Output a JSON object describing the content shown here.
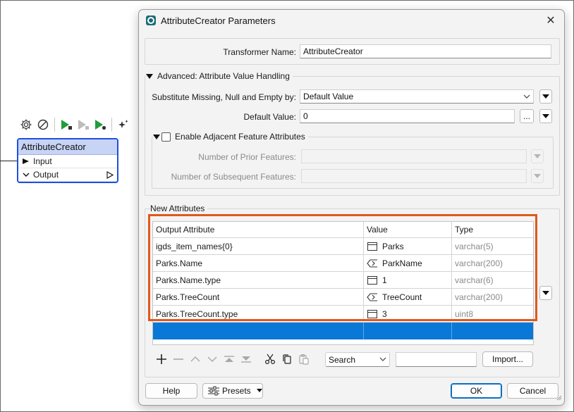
{
  "canvas": {
    "node_title": "AttributeCreator",
    "port_input": "Input",
    "port_output": "Output",
    "toolbar_icons": [
      "gear-icon",
      "disable-icon",
      "run-to-icon",
      "run-from-icon",
      "run-partial-icon",
      "sparkle-icon"
    ]
  },
  "dialog": {
    "title": "AttributeCreator Parameters",
    "transformer_name_label": "Transformer Name:",
    "transformer_name_value": "AttributeCreator",
    "advanced_section": "Advanced: Attribute Value Handling",
    "substitute_label": "Substitute Missing, Null and Empty by:",
    "substitute_value": "Default Value",
    "default_value_label": "Default Value:",
    "default_value_value": "0",
    "ellipsis": "...",
    "adjacent_label": "Enable Adjacent Feature Attributes",
    "prior_label": "Number of Prior Features:",
    "subsequent_label": "Number of Subsequent Features:",
    "new_attributes_label": "New Attributes",
    "table": {
      "headers": [
        "Output Attribute",
        "Value",
        "Type"
      ],
      "rows": [
        {
          "attr": "igds_item_names{0}",
          "icon": "constant-icon",
          "value": "Parks",
          "type": "varchar(5)"
        },
        {
          "attr": "Parks.Name",
          "icon": "attribute-icon",
          "value": "ParkName",
          "type": "varchar(200)"
        },
        {
          "attr": "Parks.Name.type",
          "icon": "constant-icon",
          "value": "1",
          "type": "varchar(6)"
        },
        {
          "attr": "Parks.TreeCount",
          "icon": "attribute-icon",
          "value": "TreeCount",
          "type": "varchar(200)"
        },
        {
          "attr": "Parks.TreeCount.type",
          "icon": "constant-icon",
          "value": "3",
          "type": "uint8"
        }
      ]
    },
    "search_value": "Search",
    "filter_value": "",
    "import_label": "Import...",
    "help_label": "Help",
    "presets_label": "Presets",
    "ok_label": "OK",
    "cancel_label": "Cancel"
  },
  "colors": {
    "node_border": "#1f4fe0",
    "selection": "#0a78d6",
    "highlight": "#e0581e"
  }
}
